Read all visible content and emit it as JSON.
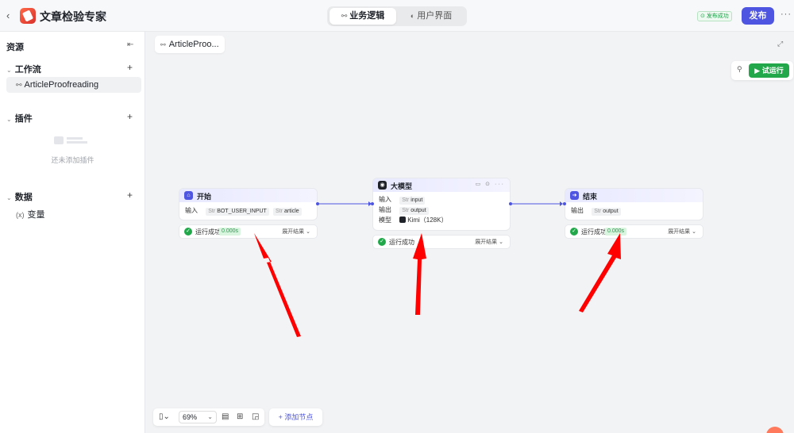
{
  "header": {
    "app_title": "文章检验专家",
    "tabs": [
      {
        "label": "业务逻辑",
        "active": true
      },
      {
        "label": "用户界面",
        "active": false
      }
    ],
    "publish_status": "发布成功",
    "publish_label": "发布"
  },
  "sidebar": {
    "title": "资源",
    "workflow_section": "工作流",
    "workflow_item": "ArticleProofreading",
    "plugin_section": "插件",
    "plugin_empty": "还未添加插件",
    "data_section": "数据",
    "variable_item": "变量"
  },
  "canvas": {
    "tab_label": "ArticleProo...",
    "run_label": "试运行",
    "zoom": "69%",
    "add_node_label": "添加节点",
    "nodes": {
      "start": {
        "title": "开始",
        "input_label": "输入",
        "inputs": [
          "BOT_USER_INPUT",
          "article"
        ],
        "status": "运行成功",
        "time": "0.000s",
        "expand": "展开结果"
      },
      "llm": {
        "title": "大模型",
        "input_label": "输入",
        "input": "input",
        "output_label": "输出",
        "output": "output",
        "model_label": "模型",
        "model": "Kimi（128K）",
        "status": "运行成功",
        "expand": "展开结果"
      },
      "end": {
        "title": "结束",
        "output_label": "输出",
        "output": "output",
        "status": "运行成功",
        "time": "0.000s",
        "expand": "展开结果"
      }
    }
  },
  "colors": {
    "accent": "#4e55e0",
    "success": "#22a84a",
    "arrow": "#ff0000"
  }
}
